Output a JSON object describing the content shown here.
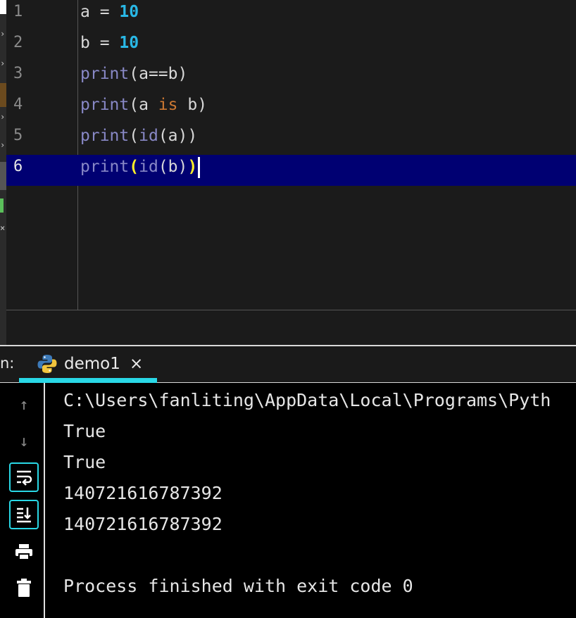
{
  "editor": {
    "lines": [
      {
        "number": "1",
        "tokens": [
          {
            "t": "a = ",
            "c": "plain"
          },
          {
            "t": "10",
            "c": "num"
          }
        ]
      },
      {
        "number": "2",
        "tokens": [
          {
            "t": "b = ",
            "c": "plain"
          },
          {
            "t": "10",
            "c": "num"
          }
        ]
      },
      {
        "number": "3",
        "tokens": [
          {
            "t": "print",
            "c": "print"
          },
          {
            "t": "(a==b)",
            "c": "plain"
          }
        ]
      },
      {
        "number": "4",
        "tokens": [
          {
            "t": "print",
            "c": "print"
          },
          {
            "t": "(a ",
            "c": "plain"
          },
          {
            "t": "is",
            "c": "is"
          },
          {
            "t": " b)",
            "c": "plain"
          }
        ]
      },
      {
        "number": "5",
        "tokens": [
          {
            "t": "print",
            "c": "print"
          },
          {
            "t": "(",
            "c": "plain"
          },
          {
            "t": "id",
            "c": "print"
          },
          {
            "t": "(a))",
            "c": "plain"
          }
        ]
      },
      {
        "number": "6",
        "tokens": [
          {
            "t": "print",
            "c": "print"
          },
          {
            "t": "(",
            "c": "paren"
          },
          {
            "t": "id",
            "c": "print"
          },
          {
            "t": "(b)",
            "c": "plain"
          },
          {
            "t": ")",
            "c": "paren"
          }
        ],
        "active": true
      }
    ]
  },
  "run_panel": {
    "label": "n:",
    "tab": {
      "title": "demo1",
      "close_label": "×",
      "icon": "python-icon"
    },
    "accent": "#29d8e6"
  },
  "toolbar": {
    "up_icon": "↑",
    "down_icon": "↓",
    "soft_wrap_icon": "soft-wrap-icon",
    "scroll_end_icon": "scroll-to-end-icon",
    "print_icon": "print-icon",
    "trash_icon": "trash-icon"
  },
  "console": {
    "lines": [
      "C:\\Users\\fanliting\\AppData\\Local\\Programs\\Pyth",
      "True",
      "True",
      "140721616787392",
      "140721616787392",
      "",
      "Process finished with exit code 0"
    ]
  }
}
